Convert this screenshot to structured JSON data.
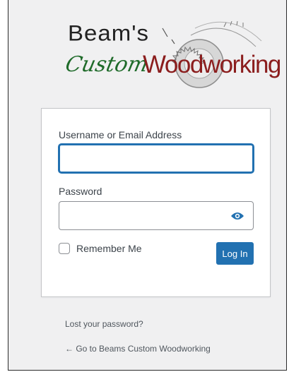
{
  "logo": {
    "line1": "Beam's",
    "line2_script": "Custom",
    "line2_main": "Woodworking"
  },
  "form": {
    "username_label": "Username or Email Address",
    "username_value": "",
    "password_label": "Password",
    "password_value": "",
    "password_toggle_icon": "eye-icon",
    "remember_label": "Remember Me",
    "remember_checked": false,
    "submit_label": "Log In"
  },
  "links": {
    "lost_password": "Lost your password?",
    "back_to_site": "← Go to Beams Custom Woodworking"
  },
  "colors": {
    "primary": "#2271b1",
    "page_background": "#f0f0f1",
    "card_background": "#ffffff",
    "logo_green": "#1f6b2a",
    "logo_red": "#8b1d1d"
  }
}
